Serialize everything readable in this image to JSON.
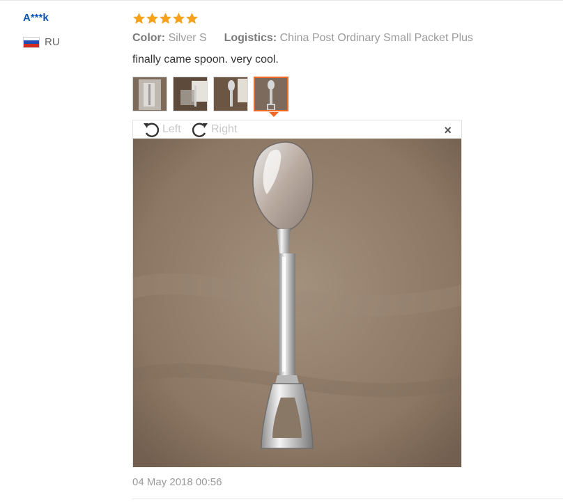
{
  "reviewer": {
    "name": "A***k",
    "country_code": "RU",
    "flag": {
      "colors": [
        "#ffffff",
        "#1f4bb8",
        "#d52b1e"
      ]
    }
  },
  "rating": {
    "stars": 5,
    "max": 5,
    "color": "#f6a21b"
  },
  "attributes": {
    "color_label": "Color:",
    "color_value": "Silver S",
    "logistics_label": "Logistics:",
    "logistics_value": "China Post Ordinary Small Packet Plus"
  },
  "review_text": "finally came spoon. very cool.",
  "thumbnails": [
    {
      "index": 1,
      "active": false
    },
    {
      "index": 2,
      "active": false
    },
    {
      "index": 3,
      "active": false
    },
    {
      "index": 4,
      "active": true
    }
  ],
  "viewer": {
    "rotate_left_label": "Left",
    "rotate_right_label": "Right",
    "close_glyph": "×"
  },
  "date": "04 May 2018 00:56",
  "colors": {
    "accent": "#f06a27",
    "name": "#0b57b8"
  }
}
